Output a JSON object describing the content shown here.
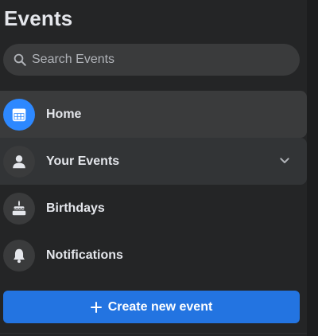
{
  "header": {
    "title": "Events"
  },
  "search": {
    "placeholder": "Search Events",
    "value": "",
    "icon": "search-icon"
  },
  "nav": {
    "items": [
      {
        "label": "Home",
        "icon": "calendar-icon",
        "active": true
      },
      {
        "label": "Your Events",
        "icon": "person-icon",
        "expandable": true
      },
      {
        "label": "Birthdays",
        "icon": "cake-icon"
      },
      {
        "label": "Notifications",
        "icon": "bell-icon"
      }
    ]
  },
  "actions": {
    "create_label": "Create new event",
    "create_icon": "plus-icon"
  },
  "colors": {
    "background": "#242526",
    "surface": "#3a3b3c",
    "accent": "#2d88ff",
    "button": "#2374e1",
    "text": "#e4e6eb",
    "muted_text": "#b0b3b8"
  }
}
